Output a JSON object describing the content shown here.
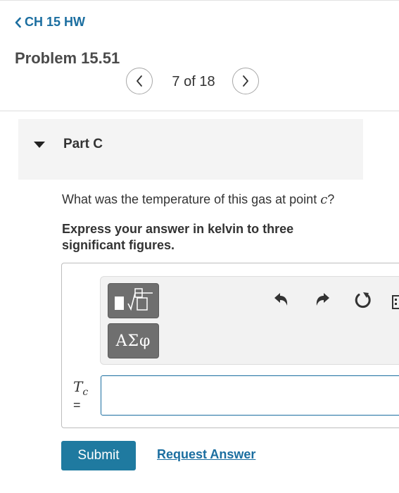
{
  "nav": {
    "back_label": "CH 15 HW"
  },
  "problem": {
    "title": "Problem 15.51"
  },
  "pager": {
    "current": 7,
    "total": 18,
    "label": "7 of 18"
  },
  "part": {
    "title": "Part C",
    "expanded": true
  },
  "question": {
    "text": "What was the temperature of this gas at point ",
    "variable": "c",
    "suffix": "?"
  },
  "instruction": "Express your answer in kelvin to three significant figures.",
  "toolbar": {
    "templates_icon": "templates-icon",
    "symbols_label": "ΑΣφ",
    "icons": [
      "undo-icon",
      "redo-icon",
      "reset-icon",
      "keyboard-icon"
    ]
  },
  "answer": {
    "variable": "T",
    "subscript": "c",
    "equals": "=",
    "value": ""
  },
  "actions": {
    "submit_label": "Submit",
    "request_label": "Request Answer"
  },
  "colors": {
    "accent": "#1b6ea0",
    "button": "#1f7aa0",
    "tool_button": "#6f6f6f"
  }
}
